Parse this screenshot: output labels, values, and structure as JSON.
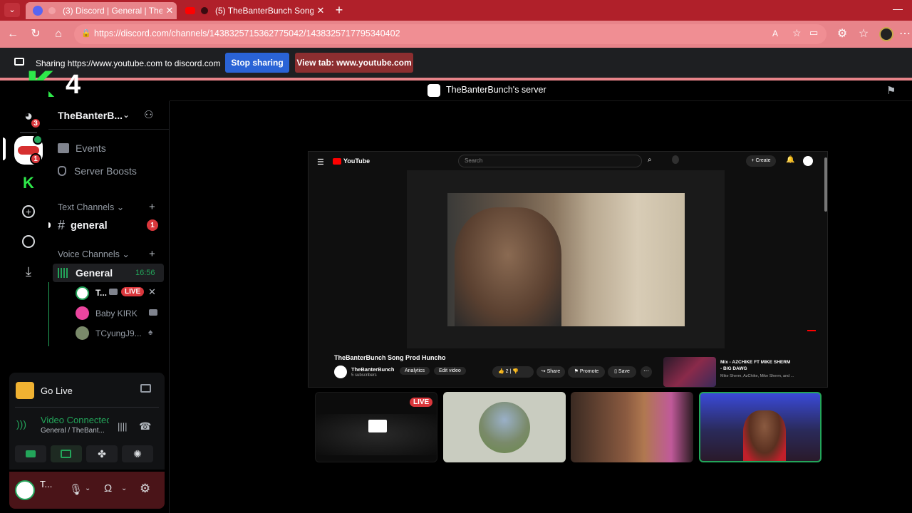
{
  "browser": {
    "tabs": [
      {
        "title": "(3) Discord | General | TheBanterBunch",
        "active": true
      },
      {
        "title": "(5) TheBanterBunch Song Prod Huncho",
        "active": false
      }
    ],
    "url": "https://discord.com/channels/1438325715362775042/1438325717795340402"
  },
  "sharebar": {
    "text": "Sharing https://www.youtube.com to discord.com",
    "stop_label": "Stop sharing",
    "view_label": "View tab: www.youtube.com"
  },
  "overlay": {
    "letter": "K",
    "number": "4"
  },
  "server": {
    "title": "TheBanterBunch's server",
    "sidebar_name": "TheBanterB...",
    "events_label": "Events",
    "boosts_label": "Server Boosts",
    "text_category": "Text Channels",
    "voice_category": "Voice Channels",
    "text_channel": "general",
    "text_channel_badge": "1",
    "voice_channel": "General",
    "voice_timer": "16:56",
    "dm_badge": "3",
    "server_badge": "1"
  },
  "voice_members": [
    {
      "name": "T...",
      "badge": "LIVE"
    },
    {
      "name": "Baby KIRK"
    },
    {
      "name": "TCyungJ9..."
    }
  ],
  "voice_panel": {
    "go_live": "Go Live",
    "status": "Video Connected",
    "location": "General / TheBant..."
  },
  "user_panel": {
    "name": "T..."
  },
  "youtube": {
    "brand": "YouTube",
    "search_placeholder": "Search",
    "create_label": "Create",
    "video_title": "TheBanterBunch Song Prod Huncho",
    "channel_name": "TheBanterBunch",
    "subscribers": "5 subscribers",
    "analytics": "Analytics",
    "edit_video": "Edit video",
    "likes": "2",
    "share": "Share",
    "promote": "Promote",
    "save": "Save",
    "mix_title_1": "Mix - AZCHIKE FT MIKE SHERM",
    "mix_title_2": "- BIG DAWG",
    "mix_sub": "Mike Sherm, AzChike, Mike Sherm, and ..."
  },
  "tiles": [
    {
      "badge": "LIVE"
    }
  ],
  "colors": {
    "tabbar": "#b0202a",
    "addressbar": "#e8848a",
    "blurple": "#3f54e4",
    "live_red": "#da373c",
    "online_green": "#23a55a"
  }
}
